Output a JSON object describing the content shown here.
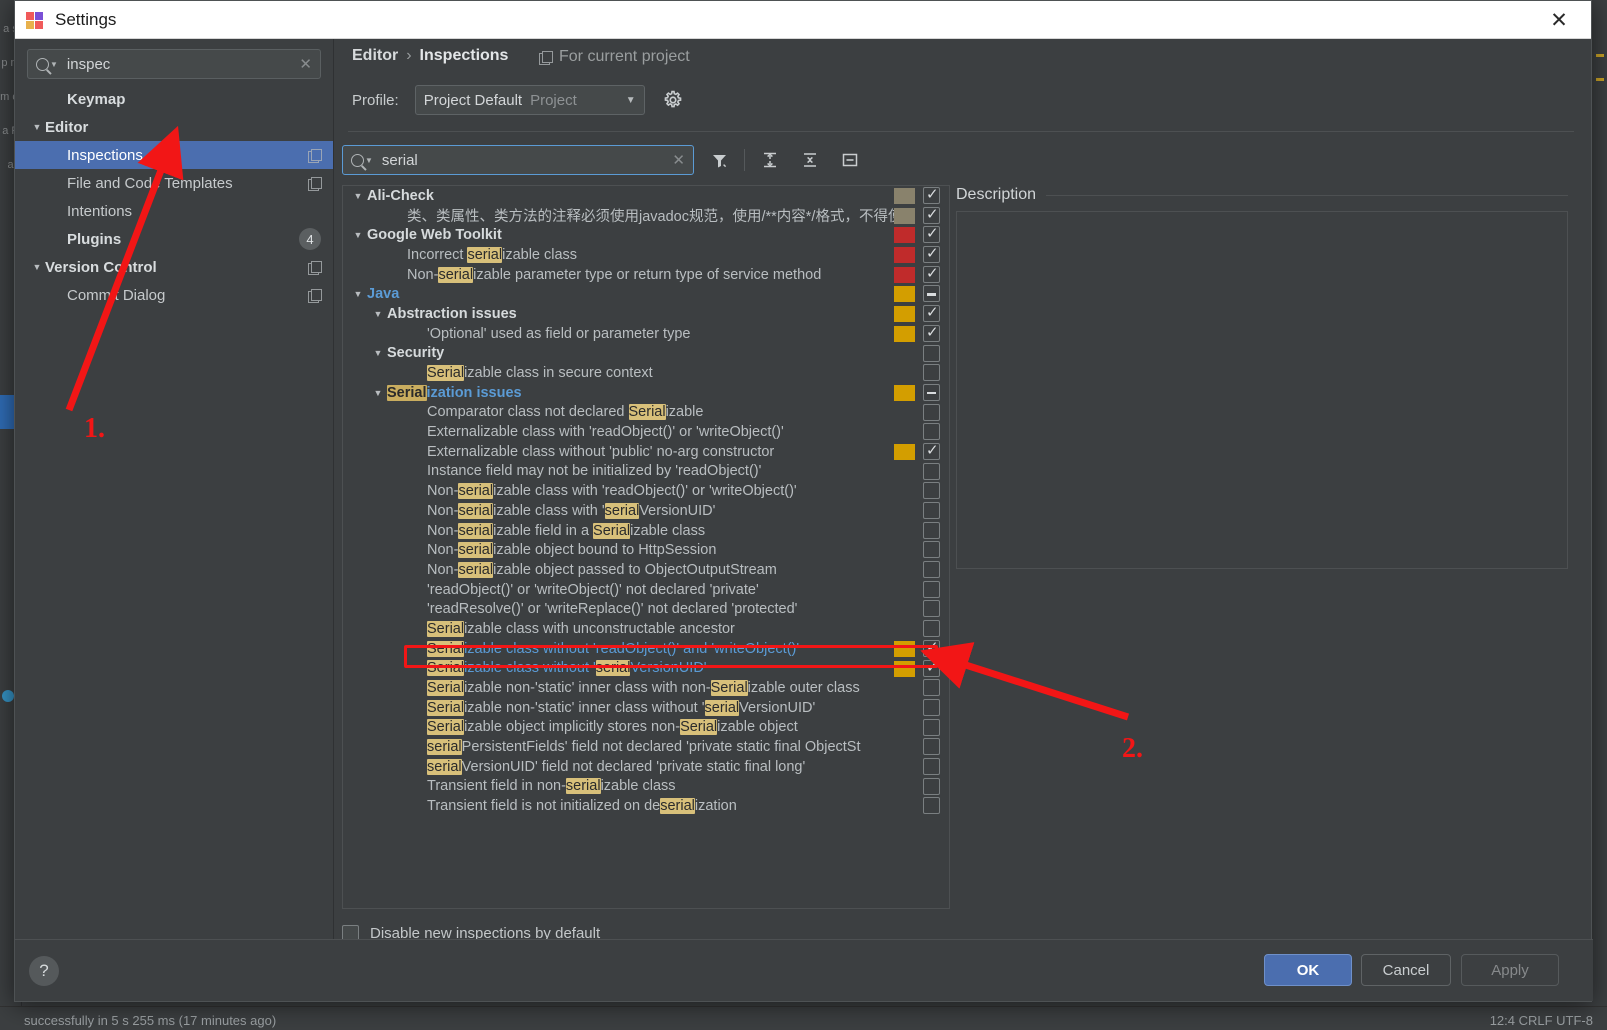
{
  "window": {
    "title": "Settings",
    "close_label": "✕",
    "app_icon": "intellij-idea-icon"
  },
  "sidebar": {
    "search": {
      "value": "inspec",
      "placeholder": "Search settings",
      "icon": "search-icon",
      "clear_icon": "clear-icon"
    },
    "items": [
      {
        "label": "Keymap",
        "indent": 1,
        "bold": true,
        "arrow": "",
        "copy": false,
        "badge": "",
        "selected": false
      },
      {
        "label": "Editor",
        "indent": 0,
        "bold": true,
        "arrow": "▼",
        "copy": false,
        "badge": "",
        "selected": false
      },
      {
        "label": "Inspections",
        "indent": 1,
        "bold": false,
        "arrow": "",
        "copy": true,
        "badge": "",
        "selected": true
      },
      {
        "label": "File and Code Templates",
        "indent": 1,
        "bold": false,
        "arrow": "",
        "copy": true,
        "badge": "",
        "selected": false
      },
      {
        "label": "Intentions",
        "indent": 1,
        "bold": false,
        "arrow": "",
        "copy": false,
        "badge": "",
        "selected": false
      },
      {
        "label": "Plugins",
        "indent": 1,
        "bold": true,
        "arrow": "",
        "copy": false,
        "badge": "4",
        "selected": false
      },
      {
        "label": "Version Control",
        "indent": 0,
        "bold": true,
        "arrow": "▼",
        "copy": true,
        "badge": "",
        "selected": false
      },
      {
        "label": "Commit Dialog",
        "indent": 1,
        "bold": false,
        "arrow": "",
        "copy": true,
        "badge": "",
        "selected": false
      }
    ]
  },
  "main": {
    "breadcrumb": {
      "parent": "Editor",
      "separator": "›",
      "current": "Inspections"
    },
    "scope": {
      "label": "For current project",
      "icon": "copy-scope-icon"
    },
    "profile": {
      "label": "Profile:",
      "value": "Project Default",
      "value_suffix": "Project",
      "caret": "▼",
      "gear_icon": "gear-icon"
    },
    "filter": {
      "value": "serial",
      "placeholder": "Filter inspections",
      "icon": "search-icon",
      "clear_icon": "clear-icon",
      "buttons": [
        {
          "name": "filter-button",
          "icon": "funnel-icon"
        },
        {
          "name": "expand-all-button",
          "icon": "expand-all-icon"
        },
        {
          "name": "collapse-all-button",
          "icon": "collapse-all-icon"
        },
        {
          "name": "show-only-enabled-button",
          "icon": "minus-box-icon"
        }
      ]
    },
    "description": {
      "title": "Description",
      "content": ""
    },
    "disable_new": {
      "label": "Disable new inspections by default",
      "checked": false
    }
  },
  "tree": {
    "rows": [
      {
        "indent": 0,
        "twisty": "▼",
        "group": true,
        "blue": false,
        "parts": [
          {
            "t": "Ali-Check",
            "h": false
          }
        ],
        "sev": "gray",
        "cb": "on"
      },
      {
        "indent": 2,
        "twisty": "",
        "group": false,
        "blue": false,
        "parts": [
          {
            "t": "类、类属性、类方法的注释必须使用javadoc规范，使用/**内容*/格式，不得使",
            "h": false
          }
        ],
        "sev": "gray",
        "cb": "on"
      },
      {
        "indent": 0,
        "twisty": "▼",
        "group": true,
        "blue": false,
        "parts": [
          {
            "t": "Google Web Toolkit",
            "h": false
          }
        ],
        "sev": "err",
        "cb": "on"
      },
      {
        "indent": 2,
        "twisty": "",
        "group": false,
        "blue": false,
        "parts": [
          {
            "t": "Incorrect ",
            "h": false
          },
          {
            "t": "serial",
            "h": true
          },
          {
            "t": "izable class",
            "h": false
          }
        ],
        "sev": "err",
        "cb": "on"
      },
      {
        "indent": 2,
        "twisty": "",
        "group": false,
        "blue": false,
        "parts": [
          {
            "t": "Non-",
            "h": false
          },
          {
            "t": "serial",
            "h": true
          },
          {
            "t": "izable parameter type or return type of service method",
            "h": false
          }
        ],
        "sev": "err",
        "cb": "on"
      },
      {
        "indent": 0,
        "twisty": "▼",
        "group": true,
        "blue": true,
        "parts": [
          {
            "t": "Java",
            "h": false
          }
        ],
        "sev": "warn",
        "cb": "part"
      },
      {
        "indent": 1,
        "twisty": "▼",
        "group": true,
        "blue": false,
        "parts": [
          {
            "t": "Abstraction issues",
            "h": false
          }
        ],
        "sev": "warn",
        "cb": "on"
      },
      {
        "indent": 3,
        "twisty": "",
        "group": false,
        "blue": false,
        "parts": [
          {
            "t": "'Optional' used as field or parameter type",
            "h": false
          }
        ],
        "sev": "warn",
        "cb": "on"
      },
      {
        "indent": 1,
        "twisty": "▼",
        "group": true,
        "blue": false,
        "parts": [
          {
            "t": "Security",
            "h": false
          }
        ],
        "sev": "",
        "cb": "off"
      },
      {
        "indent": 3,
        "twisty": "",
        "group": false,
        "blue": false,
        "parts": [
          {
            "t": "Serial",
            "h": true
          },
          {
            "t": "izable class in secure context",
            "h": false
          }
        ],
        "sev": "",
        "cb": "off"
      },
      {
        "indent": 1,
        "twisty": "▼",
        "group": true,
        "blue": true,
        "parts": [
          {
            "t": "Serial",
            "h": true
          },
          {
            "t": "ization issues",
            "h": false
          }
        ],
        "sev": "warn",
        "cb": "part"
      },
      {
        "indent": 3,
        "twisty": "",
        "group": false,
        "blue": false,
        "parts": [
          {
            "t": "Comparator class not declared ",
            "h": false
          },
          {
            "t": "Serial",
            "h": true
          },
          {
            "t": "izable",
            "h": false
          }
        ],
        "sev": "",
        "cb": "off"
      },
      {
        "indent": 3,
        "twisty": "",
        "group": false,
        "blue": false,
        "parts": [
          {
            "t": "Externalizable class with 'readObject()' or 'writeObject()'",
            "h": false
          }
        ],
        "sev": "",
        "cb": "off"
      },
      {
        "indent": 3,
        "twisty": "",
        "group": false,
        "blue": false,
        "parts": [
          {
            "t": "Externalizable class without 'public' no-arg constructor",
            "h": false
          }
        ],
        "sev": "warn",
        "cb": "on"
      },
      {
        "indent": 3,
        "twisty": "",
        "group": false,
        "blue": false,
        "parts": [
          {
            "t": "Instance field may not be initialized by 'readObject()'",
            "h": false
          }
        ],
        "sev": "",
        "cb": "off"
      },
      {
        "indent": 3,
        "twisty": "",
        "group": false,
        "blue": false,
        "parts": [
          {
            "t": "Non-",
            "h": false
          },
          {
            "t": "serial",
            "h": true
          },
          {
            "t": "izable class with 'readObject()' or 'writeObject()'",
            "h": false
          }
        ],
        "sev": "",
        "cb": "off"
      },
      {
        "indent": 3,
        "twisty": "",
        "group": false,
        "blue": false,
        "parts": [
          {
            "t": "Non-",
            "h": false
          },
          {
            "t": "serial",
            "h": true
          },
          {
            "t": "izable class with '",
            "h": false
          },
          {
            "t": "serial",
            "h": true
          },
          {
            "t": "VersionUID'",
            "h": false
          }
        ],
        "sev": "",
        "cb": "off"
      },
      {
        "indent": 3,
        "twisty": "",
        "group": false,
        "blue": false,
        "parts": [
          {
            "t": "Non-",
            "h": false
          },
          {
            "t": "serial",
            "h": true
          },
          {
            "t": "izable field in a ",
            "h": false
          },
          {
            "t": "Serial",
            "h": true
          },
          {
            "t": "izable class",
            "h": false
          }
        ],
        "sev": "",
        "cb": "off"
      },
      {
        "indent": 3,
        "twisty": "",
        "group": false,
        "blue": false,
        "parts": [
          {
            "t": "Non-",
            "h": false
          },
          {
            "t": "serial",
            "h": true
          },
          {
            "t": "izable object bound to HttpSession",
            "h": false
          }
        ],
        "sev": "",
        "cb": "off"
      },
      {
        "indent": 3,
        "twisty": "",
        "group": false,
        "blue": false,
        "parts": [
          {
            "t": "Non-",
            "h": false
          },
          {
            "t": "serial",
            "h": true
          },
          {
            "t": "izable object passed to ObjectOutputStream",
            "h": false
          }
        ],
        "sev": "",
        "cb": "off"
      },
      {
        "indent": 3,
        "twisty": "",
        "group": false,
        "blue": false,
        "parts": [
          {
            "t": "'readObject()' or 'writeObject()' not declared 'private'",
            "h": false
          }
        ],
        "sev": "",
        "cb": "off"
      },
      {
        "indent": 3,
        "twisty": "",
        "group": false,
        "blue": false,
        "parts": [
          {
            "t": "'readResolve()' or 'writeReplace()' not declared 'protected'",
            "h": false
          }
        ],
        "sev": "",
        "cb": "off"
      },
      {
        "indent": 3,
        "twisty": "",
        "group": false,
        "blue": false,
        "parts": [
          {
            "t": "Serial",
            "h": true
          },
          {
            "t": "izable class with unconstructable ancestor",
            "h": false
          }
        ],
        "sev": "",
        "cb": "off"
      },
      {
        "indent": 3,
        "twisty": "",
        "group": false,
        "blue": true,
        "parts": [
          {
            "t": "Serial",
            "h": true
          },
          {
            "t": "izable class without 'readObject()' and 'writeObject()'",
            "h": false
          }
        ],
        "sev": "warn",
        "cb": "on"
      },
      {
        "indent": 3,
        "twisty": "",
        "group": false,
        "blue": true,
        "parts": [
          {
            "t": "Serial",
            "h": true
          },
          {
            "t": "izable class without '",
            "h": false
          },
          {
            "t": "serial",
            "h": true
          },
          {
            "t": "VersionUID'",
            "h": false
          }
        ],
        "sev": "warn",
        "cb": "on"
      },
      {
        "indent": 3,
        "twisty": "",
        "group": false,
        "blue": false,
        "parts": [
          {
            "t": "Serial",
            "h": true
          },
          {
            "t": "izable non-'static' inner class with non-",
            "h": false
          },
          {
            "t": "Serial",
            "h": true
          },
          {
            "t": "izable outer class",
            "h": false
          }
        ],
        "sev": "",
        "cb": "off"
      },
      {
        "indent": 3,
        "twisty": "",
        "group": false,
        "blue": false,
        "parts": [
          {
            "t": "Serial",
            "h": true
          },
          {
            "t": "izable non-'static' inner class without '",
            "h": false
          },
          {
            "t": "serial",
            "h": true
          },
          {
            "t": "VersionUID'",
            "h": false
          }
        ],
        "sev": "",
        "cb": "off"
      },
      {
        "indent": 3,
        "twisty": "",
        "group": false,
        "blue": false,
        "parts": [
          {
            "t": "Serial",
            "h": true
          },
          {
            "t": "izable object implicitly stores non-",
            "h": false
          },
          {
            "t": "Serial",
            "h": true
          },
          {
            "t": "izable object",
            "h": false
          }
        ],
        "sev": "",
        "cb": "off"
      },
      {
        "indent": 3,
        "twisty": "",
        "group": false,
        "blue": false,
        "parts": [
          {
            "t": "serial",
            "h": true
          },
          {
            "t": "PersistentFields' field not declared 'private static final ObjectSt",
            "h": false
          }
        ],
        "sev": "",
        "cb": "off"
      },
      {
        "indent": 3,
        "twisty": "",
        "group": false,
        "blue": false,
        "parts": [
          {
            "t": "serial",
            "h": true
          },
          {
            "t": "VersionUID' field not declared 'private static final long'",
            "h": false
          }
        ],
        "sev": "",
        "cb": "off"
      },
      {
        "indent": 3,
        "twisty": "",
        "group": false,
        "blue": false,
        "parts": [
          {
            "t": "Transient field in non-",
            "h": false
          },
          {
            "t": "serial",
            "h": true
          },
          {
            "t": "izable class",
            "h": false
          }
        ],
        "sev": "",
        "cb": "off"
      },
      {
        "indent": 3,
        "twisty": "",
        "group": false,
        "blue": false,
        "parts": [
          {
            "t": "Transient field is not initialized on de",
            "h": false
          },
          {
            "t": "serial",
            "h": true
          },
          {
            "t": "ization",
            "h": false
          }
        ],
        "sev": "",
        "cb": "off"
      }
    ]
  },
  "footer": {
    "help_label": "?",
    "ok_label": "OK",
    "cancel_label": "Cancel",
    "apply_label": "Apply"
  },
  "annotations": {
    "step1": "1.",
    "step2": "2.",
    "color": "#f21616"
  },
  "ide": {
    "status_left": "successfully in 5 s 255 ms (17 minutes ago)",
    "status_right": "12:4   CRLF  UTF-8"
  }
}
